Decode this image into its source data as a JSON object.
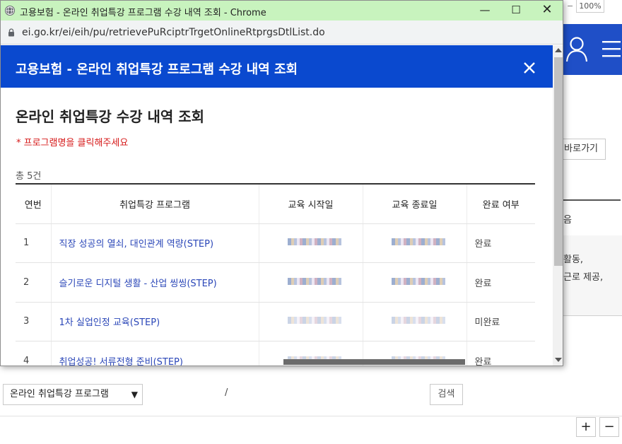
{
  "background": {
    "zoom_level": "100%",
    "zoom_minus": "−",
    "goto_button": "바로가기",
    "text_eum": "음",
    "text_hwaldong": "활동,",
    "text_geunro": "근로 제공,",
    "program_select_value": "온라인 취업특강 프로그램",
    "slash": "/",
    "search_button": "검색",
    "zoom_in": "+",
    "zoom_out": "−",
    "header_color": "#1f4fc7"
  },
  "window": {
    "title": "고용보험 - 온라인 취업특강 프로그램 수강 내역 조회 - Chrome",
    "minimize": "—",
    "maximize": "☐",
    "close": "✕",
    "url": "ei.go.kr/ei/eih/pu/retrievePuRciptrTrgetOnlineRtprgsDtlList.do",
    "title_bar_color": "#c8f3be"
  },
  "dialog": {
    "title": "고용보험 - 온라인 취업특강 프로그램 수강 내역 조회",
    "header_color": "#0a49cf",
    "section_title": "온라인 취업특강 수강 내역 조회",
    "notice": "* 프로그램명을 클릭해주세요",
    "total": "총 5건",
    "columns": [
      "연번",
      "취업특강 프로그램",
      "교육 시작일",
      "교육 종료일",
      "완료 여부"
    ],
    "rows": [
      {
        "no": "1",
        "program": "직장 성공의 열쇠, 대인관계 역량(STEP)",
        "status": "완료"
      },
      {
        "no": "2",
        "program": "슬기로운 디지털 생활 - 산업 씽씽(STEP)",
        "status": "완료"
      },
      {
        "no": "3",
        "program": "1차 실업인정 교육(STEP)",
        "status": "미완료"
      },
      {
        "no": "4",
        "program": "취업성공! 서류전형 준비(STEP)",
        "status": "완료"
      }
    ]
  }
}
